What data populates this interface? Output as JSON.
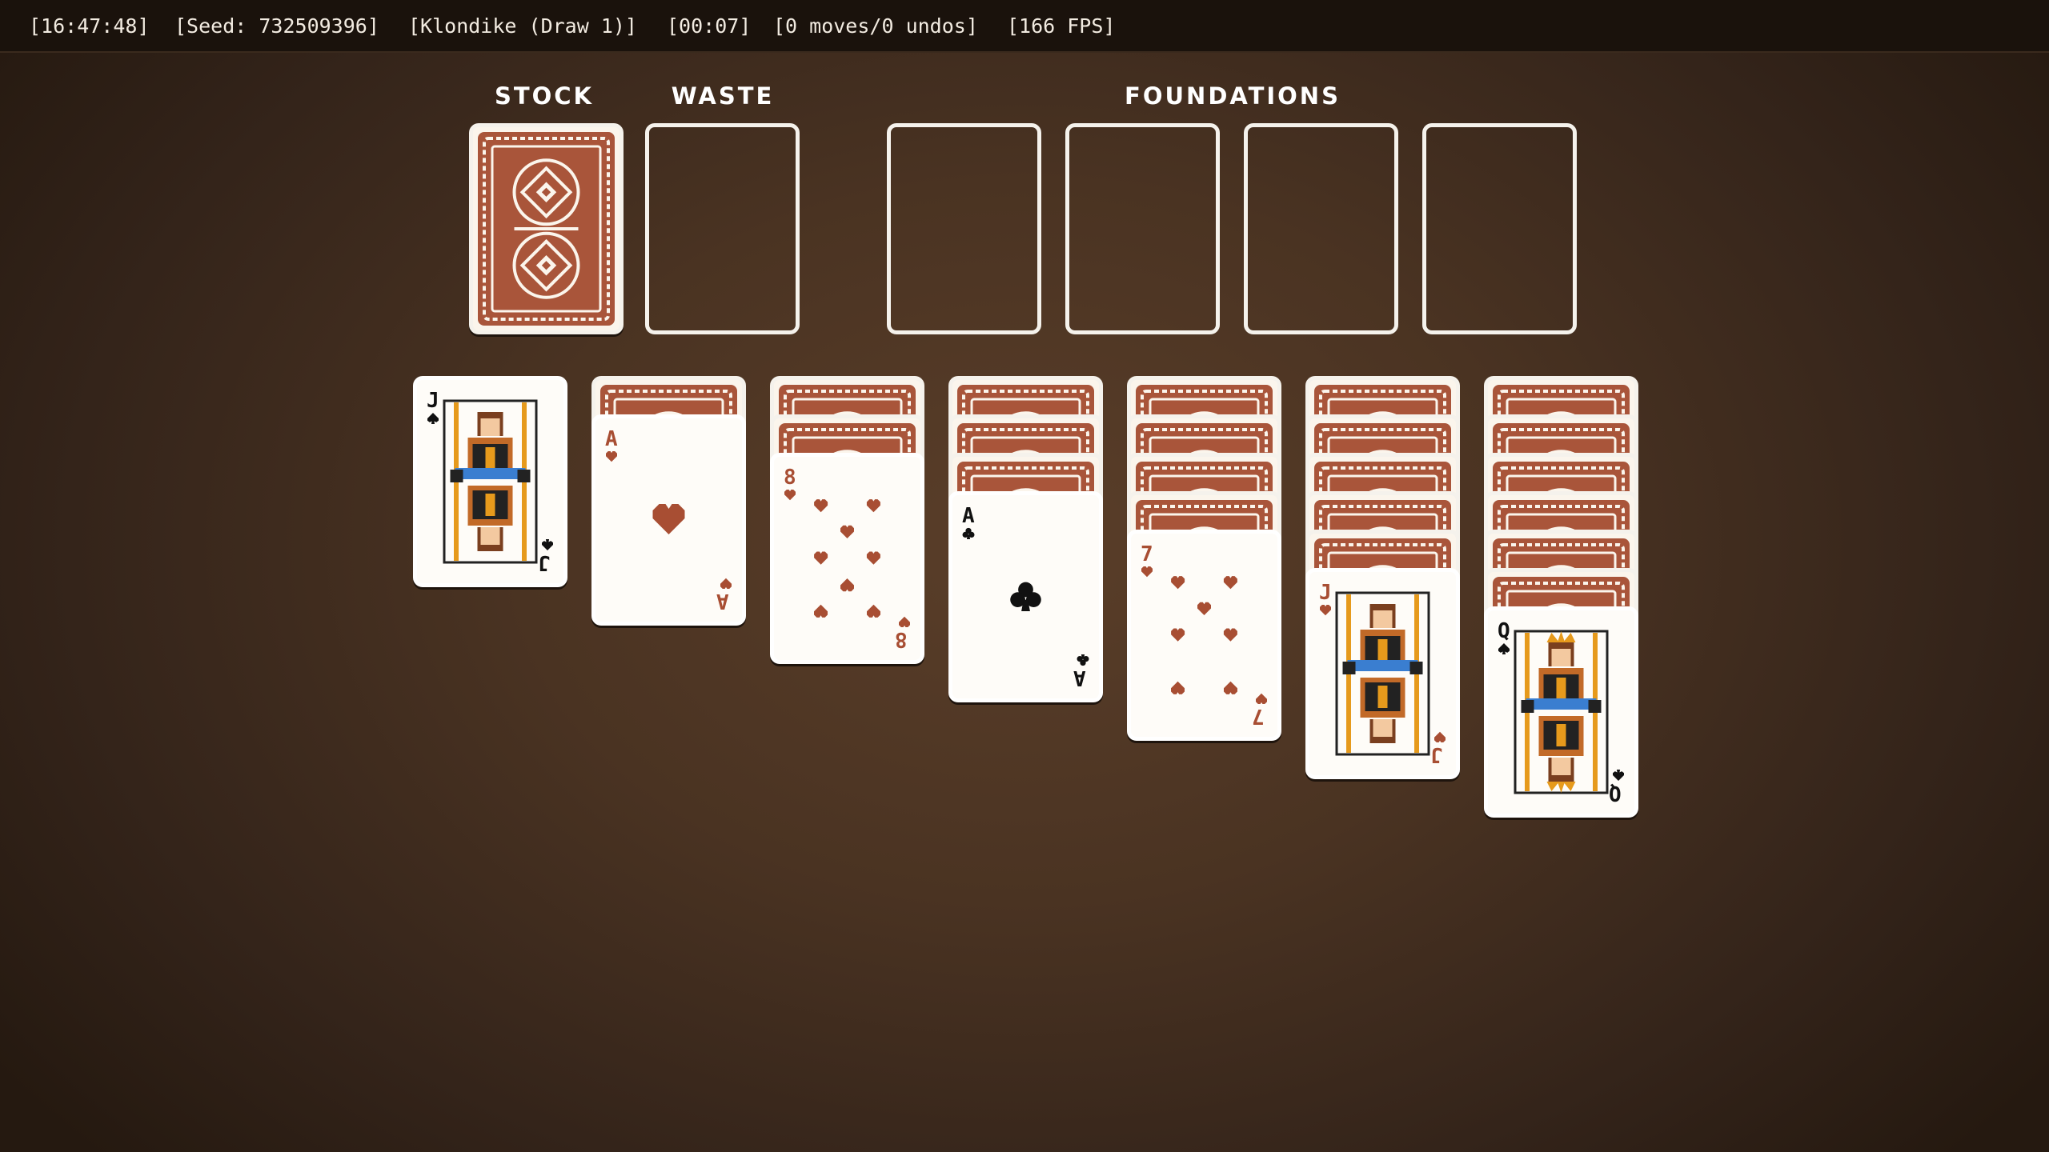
{
  "status": {
    "time": "[16:47:48]",
    "seed": "[Seed: 732509396]",
    "mode": "[Klondike (Draw 1)]",
    "elapsed": "[00:07]",
    "moves": "[0 moves/0 undos]",
    "fps": "[166 FPS]"
  },
  "labels": {
    "stock": "STOCK",
    "waste": "WASTE",
    "foundations": "FOUNDATIONS"
  },
  "stock": {
    "face_down": true
  },
  "waste": {
    "cards": []
  },
  "foundations": [
    [],
    [],
    [],
    []
  ],
  "tableau": [
    {
      "face_down_count": 0,
      "face_up": {
        "rank": "J",
        "suit": "spades",
        "color": "black"
      }
    },
    {
      "face_down_count": 1,
      "face_up": {
        "rank": "A",
        "suit": "hearts",
        "color": "red"
      }
    },
    {
      "face_down_count": 2,
      "face_up": {
        "rank": "8",
        "suit": "hearts",
        "color": "red"
      }
    },
    {
      "face_down_count": 3,
      "face_up": {
        "rank": "A",
        "suit": "clubs",
        "color": "black"
      }
    },
    {
      "face_down_count": 4,
      "face_up": {
        "rank": "7",
        "suit": "hearts",
        "color": "red"
      }
    },
    {
      "face_down_count": 5,
      "face_up": {
        "rank": "J",
        "suit": "hearts",
        "color": "red"
      }
    },
    {
      "face_down_count": 6,
      "face_up": {
        "rank": "Q",
        "suit": "spades",
        "color": "black"
      }
    }
  ],
  "colors": {
    "red_suit": "#a84e33",
    "black_suit": "#111111",
    "card_back": "#a9553a",
    "background": "#4a3322"
  }
}
